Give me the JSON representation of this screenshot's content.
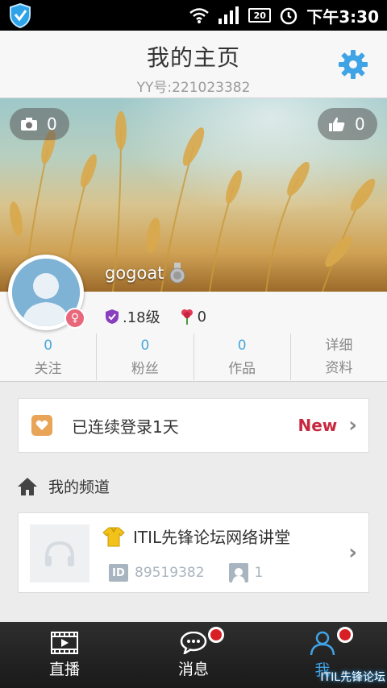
{
  "status_bar": {
    "battery": "20",
    "time": "下午3:30"
  },
  "header": {
    "title": "我的主页",
    "yy_id": "YY号:221023382",
    "settings_icon": "gear-icon"
  },
  "banner": {
    "photo_count": "0",
    "like_count": "0",
    "username": "gogoat"
  },
  "profile": {
    "level_label": ".18级",
    "flower_count": "0",
    "stats": [
      {
        "value": "0",
        "label": "关注"
      },
      {
        "value": "0",
        "label": "粉丝"
      },
      {
        "value": "0",
        "label": "作品"
      }
    ],
    "details_line1": "详细",
    "details_line2": "资料"
  },
  "login_card": {
    "text": "已连续登录1天",
    "badge": "New"
  },
  "channel_section": {
    "title": "我的频道",
    "channel_name": "ITIL先锋论坛网络讲堂",
    "channel_id": "89519382",
    "member_count": "1"
  },
  "bottom_nav": {
    "items": [
      {
        "label": "直播",
        "icon": "film-icon"
      },
      {
        "label": "消息",
        "icon": "chat-icon"
      },
      {
        "label": "我",
        "icon": "person-icon"
      }
    ]
  },
  "watermark": "ITIL先锋论坛",
  "colors": {
    "accent": "#3fa3e6",
    "new_badge": "#c8283f",
    "stat_number": "#4aa6dc",
    "notification_dot": "#d91f26"
  }
}
